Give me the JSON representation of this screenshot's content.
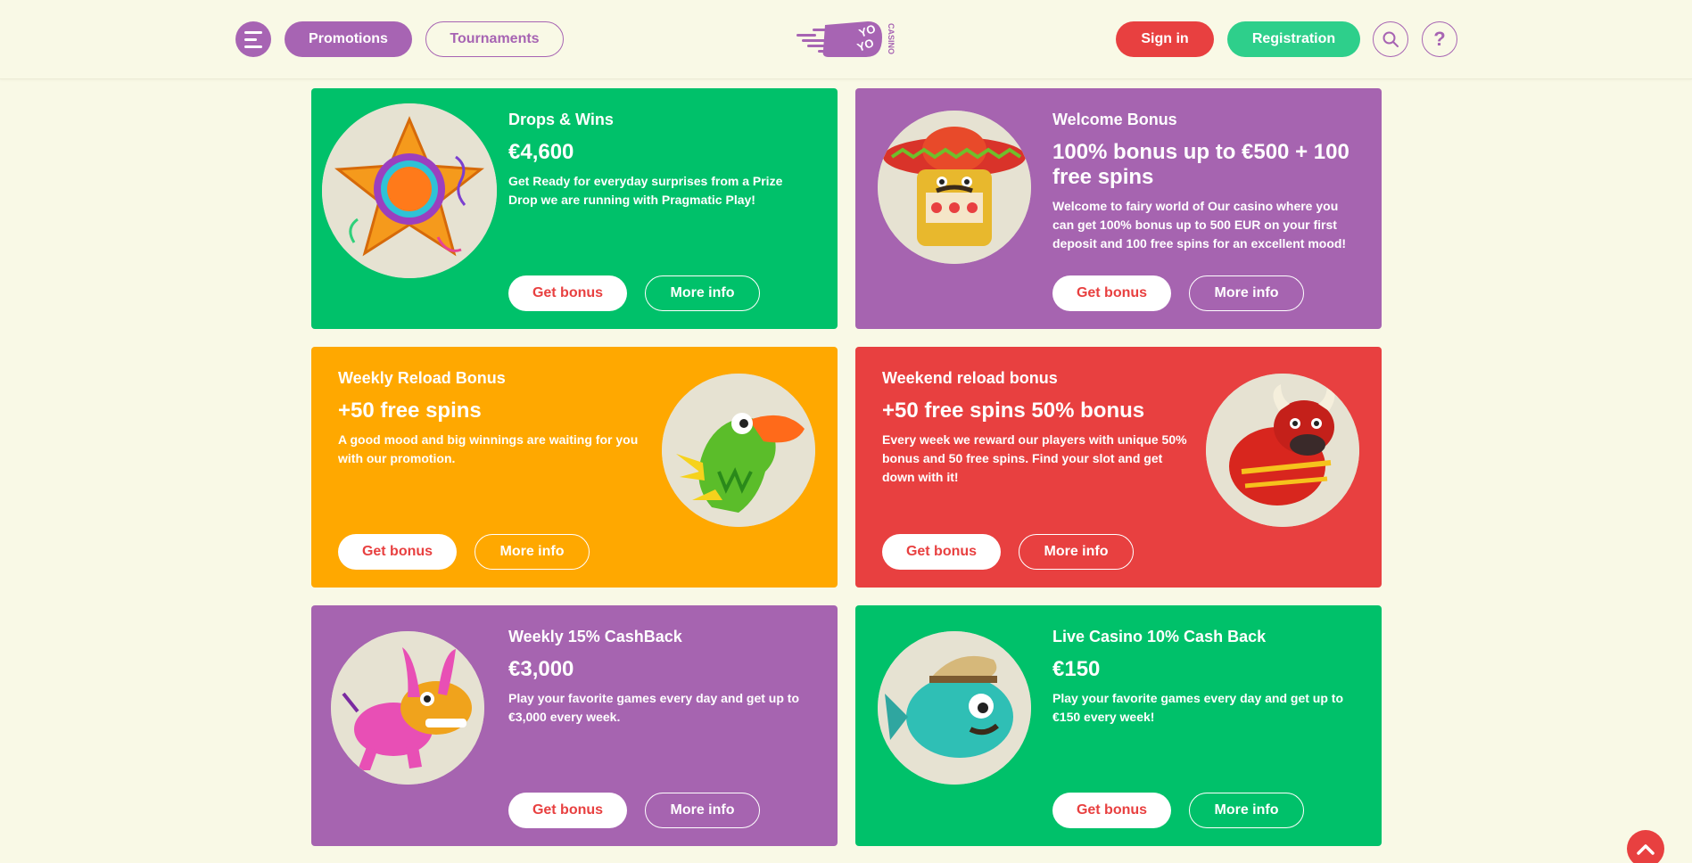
{
  "header": {
    "promotions_label": "Promotions",
    "tournaments_label": "Tournaments",
    "logo_text_top": "YO",
    "logo_text_bottom": "YO",
    "logo_text_side": "CASINO",
    "signin_label": "Sign in",
    "register_label": "Registration",
    "help_label": "?"
  },
  "cards": [
    {
      "title": "Drops & Wins",
      "amount": "€4,600",
      "desc": "Get Ready for everyday surprises from a Prize Drop we are running with Pragmatic Play!",
      "get_label": "Get bonus",
      "more_label": "More info",
      "color": "#00c16a",
      "icon": "pinata-star-icon"
    },
    {
      "title": "Welcome Bonus",
      "amount": "100% bonus up to €500 + 100 free spins",
      "desc": "Welcome to fairy world of Our casino where you can get 100% bonus up to 500 EUR on your first deposit and 100 free spins for an excellent mood!",
      "get_label": "Get bonus",
      "more_label": "More info",
      "color": "#a664b0",
      "icon": "slot-machine-sombrero-icon"
    },
    {
      "title": "Weekly Reload Bonus",
      "amount": "+50 free spins",
      "desc": "A good mood and big winnings are waiting for you with our promotion.",
      "get_label": "Get bonus",
      "more_label": "More info",
      "color": "#ffa800",
      "icon": "toucan-pinata-icon"
    },
    {
      "title": "Weekend reload bonus",
      "amount": "+50 free spins 50% bonus",
      "desc": "Every week we reward our players with unique 50% bonus and 50 free spins. Find your slot and get down with it!",
      "get_label": "Get bonus",
      "more_label": "More info",
      "color": "#e84040",
      "icon": "bull-pinata-icon"
    },
    {
      "title": "Weekly 15% CashBack",
      "amount": "€3,000",
      "desc": "Play your favorite games every day and get up to €3,000 every week.",
      "get_label": "Get bonus",
      "more_label": "More info",
      "color": "#a664b0",
      "icon": "donkey-pinata-icon"
    },
    {
      "title": "Live Casino 10% Cash Back",
      "amount": "€150",
      "desc": "Play your favorite games every day and get up to €150 every week!",
      "get_label": "Get bonus",
      "more_label": "More info",
      "color": "#00c16a",
      "icon": "fish-pinata-icon"
    }
  ]
}
